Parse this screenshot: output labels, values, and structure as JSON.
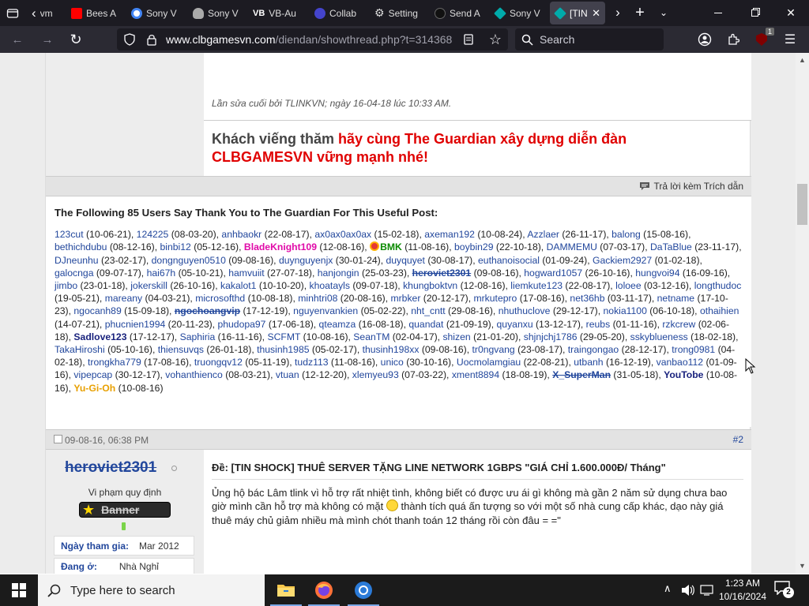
{
  "tabs": [
    {
      "label": "vm",
      "color": "#888"
    },
    {
      "label": "Bees A",
      "color": "#ff0000"
    },
    {
      "label": "Sony V",
      "color": "#4285f4"
    },
    {
      "label": "Sony V",
      "color": "#cccccc"
    },
    {
      "label": "VB-Au",
      "color": "#ffffff"
    },
    {
      "label": "Collab",
      "color": "#4444cc"
    },
    {
      "label": "Setting",
      "color": "#cccccc"
    },
    {
      "label": "Send A",
      "color": "#333333"
    },
    {
      "label": "Sony V",
      "color": "#00aaaa"
    },
    {
      "label": "[TIN",
      "color": "#00aaaa"
    }
  ],
  "url": {
    "host": "www.clbgamesvn.com",
    "path": "/diendan/showthread.php?t=314368"
  },
  "search_placeholder": "Search",
  "ext_badge": "1",
  "post1": {
    "edited": "Lần sửa cuối bởi TLINKVN; ngày 16-04-18 lúc 10:33 AM.",
    "sig_part1": "Khách viếng thăm ",
    "sig_part2": "hãy cùng The Guardian xây dựng diễn đàn",
    "sig_part3": "CLBGAMESVN vững mạnh nhé!"
  },
  "reply_quote": "Trả lời kèm Trích dẫn",
  "thanks": {
    "header": "The Following 85 Users Say Thank You to The Guardian For This Useful Post:",
    "users": [
      {
        "name": "123cut",
        "date": "(10-06-21)"
      },
      {
        "name": "124225",
        "date": "(08-03-20)"
      },
      {
        "name": "anhbaokr",
        "date": "(22-08-17)"
      },
      {
        "name": "ax0ax0ax0ax",
        "date": "(15-02-18)"
      },
      {
        "name": "axeman192",
        "date": "(10-08-24)"
      },
      {
        "name": "Azzlaer",
        "date": "(26-11-17)"
      },
      {
        "name": "balong",
        "date": "(15-08-16)"
      },
      {
        "name": "bethichdubu",
        "date": "(08-12-16)"
      },
      {
        "name": "binbi12",
        "date": "(05-12-16)"
      },
      {
        "name": "BladeKnight109",
        "date": "(12-08-16)",
        "style": "pink"
      },
      {
        "name": "BMK",
        "date": "(11-08-16)",
        "style": "green"
      },
      {
        "name": "boybin29",
        "date": "(22-10-18)"
      },
      {
        "name": "DAMMEMU",
        "date": "(07-03-17)"
      },
      {
        "name": "DaTaBlue",
        "date": "(23-11-17)"
      },
      {
        "name": "DJneunhu",
        "date": "(23-02-17)"
      },
      {
        "name": "dongnguyen0510",
        "date": "(09-08-16)"
      },
      {
        "name": "duynguyenjx",
        "date": "(30-01-24)"
      },
      {
        "name": "duyquyet",
        "date": "(30-08-17)"
      },
      {
        "name": "euthanoisocial",
        "date": "(01-09-24)"
      },
      {
        "name": "Gackiem2927",
        "date": "(01-02-18)"
      },
      {
        "name": "galocnga",
        "date": "(09-07-17)"
      },
      {
        "name": "hai67h",
        "date": "(05-10-21)"
      },
      {
        "name": "hamvuiit",
        "date": "(27-07-18)"
      },
      {
        "name": "hanjongin",
        "date": "(25-03-23)"
      },
      {
        "name": "heroviet2301",
        "date": "(09-08-16)",
        "style": "strike"
      },
      {
        "name": "hogward1057",
        "date": "(26-10-16)"
      },
      {
        "name": "hungvoi94",
        "date": "(16-09-16)"
      },
      {
        "name": "jimbo",
        "date": "(23-01-18)"
      },
      {
        "name": "jokerskill",
        "date": "(26-10-16)"
      },
      {
        "name": "kakalot1",
        "date": "(10-10-20)"
      },
      {
        "name": "khoatayls",
        "date": "(09-07-18)"
      },
      {
        "name": "khungboktvn",
        "date": "(12-08-16)"
      },
      {
        "name": "liemkute123",
        "date": "(22-08-17)"
      },
      {
        "name": "loloee",
        "date": "(03-12-16)"
      },
      {
        "name": "longthudoc",
        "date": "(19-05-21)"
      },
      {
        "name": "mareany",
        "date": "(04-03-21)"
      },
      {
        "name": "microsofthd",
        "date": "(10-08-18)"
      },
      {
        "name": "minhtri08",
        "date": "(20-08-16)"
      },
      {
        "name": "mrbker",
        "date": "(20-12-17)"
      },
      {
        "name": "mrkutepro",
        "date": "(17-08-16)"
      },
      {
        "name": "net36hb",
        "date": "(03-11-17)"
      },
      {
        "name": "netname",
        "date": "(17-10-23)"
      },
      {
        "name": "ngocanh89",
        "date": "(15-09-18)"
      },
      {
        "name": "ngochoangvip",
        "date": "(17-12-19)",
        "style": "strike"
      },
      {
        "name": "nguyenvankien",
        "date": "(05-02-22)"
      },
      {
        "name": "nht_cntt",
        "date": "(29-08-16)"
      },
      {
        "name": "nhuthuclove",
        "date": "(29-12-17)"
      },
      {
        "name": "nokia1100",
        "date": "(06-10-18)"
      },
      {
        "name": "othaihien",
        "date": "(14-07-21)"
      },
      {
        "name": "phucnien1994",
        "date": "(20-11-23)"
      },
      {
        "name": "phudopa97",
        "date": "(17-06-18)"
      },
      {
        "name": "qteamza",
        "date": "(16-08-18)"
      },
      {
        "name": "quandat",
        "date": "(21-09-19)"
      },
      {
        "name": "quyanxu",
        "date": "(13-12-17)"
      },
      {
        "name": "reubs",
        "date": "(01-11-16)"
      },
      {
        "name": "rzkcrew",
        "date": "(02-06-18)"
      },
      {
        "name": "Sadlove123",
        "date": "(17-12-17)",
        "style": "bold"
      },
      {
        "name": "Saphiria",
        "date": "(16-11-16)"
      },
      {
        "name": "SCFMT",
        "date": "(10-08-16)"
      },
      {
        "name": "SeanTM",
        "date": "(02-04-17)"
      },
      {
        "name": "shizen",
        "date": "(21-01-20)"
      },
      {
        "name": "shjnjchj1786",
        "date": "(29-05-20)"
      },
      {
        "name": "sskyblueness",
        "date": "(18-02-18)"
      },
      {
        "name": "TakaHiroshi",
        "date": "(05-10-16)"
      },
      {
        "name": "thiensuvqs",
        "date": "(26-01-18)"
      },
      {
        "name": "thusinh1985",
        "date": "(05-02-17)"
      },
      {
        "name": "thusinh198xx",
        "date": "(09-08-16)"
      },
      {
        "name": "tr0ngvang",
        "date": "(23-08-17)"
      },
      {
        "name": "traingongao",
        "date": "(28-12-17)"
      },
      {
        "name": "trong0981",
        "date": "(04-02-18)"
      },
      {
        "name": "trongkha779",
        "date": "(17-08-16)"
      },
      {
        "name": "truongqv12",
        "date": "(05-11-19)"
      },
      {
        "name": "tudz113",
        "date": "(11-08-16)"
      },
      {
        "name": "unico",
        "date": "(30-10-16)"
      },
      {
        "name": "Uocmolamgiau",
        "date": "(22-08-21)"
      },
      {
        "name": "utbanh",
        "date": "(16-12-19)"
      },
      {
        "name": "vanbao112",
        "date": "(01-09-16)"
      },
      {
        "name": "vipepcap",
        "date": "(30-12-17)"
      },
      {
        "name": "vohanthienco",
        "date": "(08-03-21)"
      },
      {
        "name": "vtuan",
        "date": "(12-12-20)"
      },
      {
        "name": "xlemyeu93",
        "date": "(07-03-22)"
      },
      {
        "name": "xment8894",
        "date": "(18-08-19)"
      },
      {
        "name": "X_SuperMan",
        "date": "(31-05-18)",
        "style": "strike"
      },
      {
        "name": "YouTobe",
        "date": "(10-08-16)",
        "style": "bold"
      },
      {
        "name": "Yu-Gi-Oh",
        "date": "(10-08-16)",
        "style": "orange"
      }
    ]
  },
  "post2": {
    "date": "09-08-16, 06:38 PM",
    "number": "#2",
    "username": "heroviet2301",
    "usertitle": "Vi phạm quy định",
    "banner": "Banner",
    "join_label": "Ngày tham gia:",
    "join_value": "Mar 2012",
    "loc_label": "Đang ở:",
    "loc_value": "Nhà Nghỉ",
    "title": "Đề: [TIN SHOCK] THUÊ SERVER TẶNG LINE NETWORK 1GBPS \"GIÁ CHỈ 1.600.000Đ/ Tháng\"",
    "body1": "Ủng hộ bác Lâm tlink vì hỗ trợ rất nhiệt tình, không biết có được ưu ái gì không mà gần 2 năm sử dụng chưa bao giờ mình cần hỗ trợ mà không có mặt",
    "body2": " thành tích quá ấn tượng so với một số nhà cung cấp khác, dạo này giá thuê máy chủ giảm nhiều mà mình chót thanh toán 12 tháng rồi còn đâu = =\""
  },
  "taskbar": {
    "search": "Type here to search",
    "time": "1:23 AM",
    "date": "10/16/2024",
    "notif": "2"
  }
}
